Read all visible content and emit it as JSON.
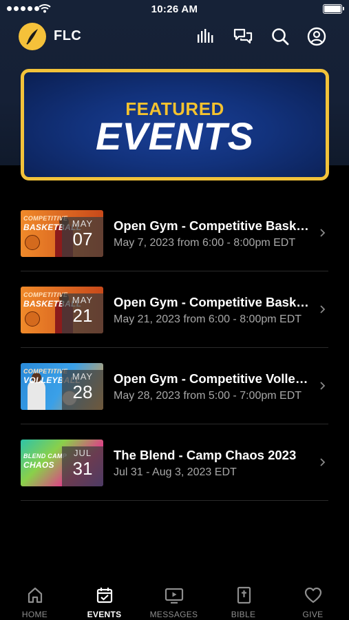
{
  "status_bar": {
    "time": "10:26 AM"
  },
  "header": {
    "app_name": "FLC",
    "icons": [
      "logo-icon",
      "audio-bars-icon",
      "chat-icon",
      "search-icon",
      "profile-icon"
    ]
  },
  "banner": {
    "kicker": "FEATURED",
    "title": "EVENTS"
  },
  "events": [
    {
      "title": "Open Gym - Competitive Basketball",
      "subtitle": "May 7, 2023 from 6:00 - 8:00pm EDT",
      "month": "MAY",
      "day": "07",
      "thumb_top": "COMPETITIVE",
      "thumb_main": "BASKETBALL",
      "thumb_colors": [
        "#f08a2a",
        "#c8491a"
      ]
    },
    {
      "title": "Open Gym - Competitive Basketball",
      "subtitle": "May 21, 2023 from 6:00 - 8:00pm EDT",
      "month": "MAY",
      "day": "21",
      "thumb_top": "COMPETITIVE",
      "thumb_main": "BASKETBALL",
      "thumb_colors": [
        "#f08a2a",
        "#c8491a"
      ]
    },
    {
      "title": "Open Gym - Competitive Volleyball",
      "subtitle": "May 28, 2023 from 5:00 - 7:00pm EDT",
      "month": "MAY",
      "day": "28",
      "thumb_top": "COMPETITIVE",
      "thumb_main": "VOLLEYBALL",
      "thumb_colors": [
        "#2a8ad8",
        "#f3a23a"
      ]
    },
    {
      "title": "The Blend - Camp Chaos 2023",
      "subtitle": "Jul 31 - Aug 3, 2023 EDT",
      "month": "JUL",
      "day": "31",
      "thumb_top": "BLEND CAMP",
      "thumb_main": "CHAOS",
      "thumb_colors": [
        "#2ec4a8",
        "#e23a8a"
      ]
    }
  ],
  "tabs": [
    {
      "label": "HOME",
      "icon": "home-icon",
      "active": false
    },
    {
      "label": "EVENTS",
      "icon": "calendar-icon",
      "active": true
    },
    {
      "label": "MESSAGES",
      "icon": "tv-icon",
      "active": false
    },
    {
      "label": "BIBLE",
      "icon": "bible-icon",
      "active": false
    },
    {
      "label": "GIVE",
      "icon": "heart-icon",
      "active": false
    }
  ],
  "colors": {
    "accent": "#f2c23a",
    "background": "#000000",
    "header_bg": "#162237",
    "banner_blue": "#12327c",
    "subtext": "#a8a8a8"
  }
}
